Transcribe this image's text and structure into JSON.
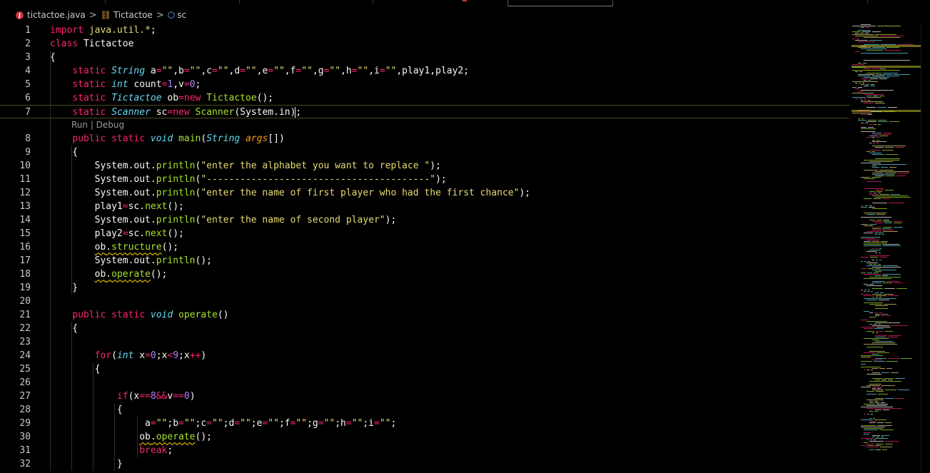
{
  "breadcrumb": {
    "file_icon": "java-file-icon",
    "file": "tictactoe.java",
    "class_icon": "class-icon",
    "class_name": "Tictactoe",
    "field_icon": "field-icon",
    "field": "sc",
    "separator": ">"
  },
  "codelens": {
    "text": "Run | Debug",
    "run": "Run",
    "debug": "Debug"
  },
  "theme": {
    "keyword": "#f92672",
    "type": "#66d9ef",
    "string": "#e6db74",
    "number": "#ae81ff",
    "function": "#a6e22e",
    "param": "#fd971f"
  },
  "lines": [
    {
      "n": "1",
      "tokens": [
        [
          "kw",
          "import"
        ],
        [
          "pl",
          " "
        ],
        [
          "st",
          "java.util.*"
        ],
        [
          "pl",
          ";"
        ]
      ]
    },
    {
      "n": "2",
      "tokens": [
        [
          "kw",
          "class"
        ],
        [
          "pl",
          " Tictactoe"
        ]
      ]
    },
    {
      "n": "3",
      "tokens": [
        [
          "pl",
          "{"
        ]
      ]
    },
    {
      "n": "4",
      "tokens": [
        [
          "pl",
          "    "
        ],
        [
          "kw",
          "static"
        ],
        [
          "pl",
          " "
        ],
        [
          "ty",
          "String"
        ],
        [
          "pl",
          " a"
        ],
        [
          "op",
          "="
        ],
        [
          "st",
          "\"\""
        ],
        [
          "pl",
          ",b"
        ],
        [
          "op",
          "="
        ],
        [
          "st",
          "\"\""
        ],
        [
          "pl",
          ",c"
        ],
        [
          "op",
          "="
        ],
        [
          "st",
          "\"\""
        ],
        [
          "pl",
          ",d"
        ],
        [
          "op",
          "="
        ],
        [
          "st",
          "\"\""
        ],
        [
          "pl",
          ",e"
        ],
        [
          "op",
          "="
        ],
        [
          "st",
          "\"\""
        ],
        [
          "pl",
          ",f"
        ],
        [
          "op",
          "="
        ],
        [
          "st",
          "\"\""
        ],
        [
          "pl",
          ",g"
        ],
        [
          "op",
          "="
        ],
        [
          "st",
          "\"\""
        ],
        [
          "pl",
          ",h"
        ],
        [
          "op",
          "="
        ],
        [
          "st",
          "\"\""
        ],
        [
          "pl",
          ",i"
        ],
        [
          "op",
          "="
        ],
        [
          "st",
          "\"\""
        ],
        [
          "pl",
          ",play1,play2;"
        ]
      ]
    },
    {
      "n": "5",
      "tokens": [
        [
          "pl",
          "    "
        ],
        [
          "kw",
          "static"
        ],
        [
          "pl",
          " "
        ],
        [
          "ty",
          "int"
        ],
        [
          "pl",
          " count"
        ],
        [
          "op",
          "="
        ],
        [
          "nu",
          "1"
        ],
        [
          "pl",
          ",v"
        ],
        [
          "op",
          "="
        ],
        [
          "nu",
          "0"
        ],
        [
          "pl",
          ";"
        ]
      ]
    },
    {
      "n": "6",
      "tokens": [
        [
          "pl",
          "    "
        ],
        [
          "kw",
          "static"
        ],
        [
          "pl",
          " "
        ],
        [
          "ty",
          "Tictactoe"
        ],
        [
          "pl",
          " ob"
        ],
        [
          "op",
          "="
        ],
        [
          "kw",
          "new"
        ],
        [
          "pl",
          " "
        ],
        [
          "fn",
          "Tictactoe"
        ],
        [
          "pl",
          "();"
        ]
      ]
    },
    {
      "n": "7",
      "tokens": [
        [
          "pl",
          "    "
        ],
        [
          "kw",
          "static"
        ],
        [
          "pl",
          " "
        ],
        [
          "ty",
          "Scanner"
        ],
        [
          "pl",
          " sc"
        ],
        [
          "op",
          "="
        ],
        [
          "kw",
          "new"
        ],
        [
          "pl",
          " "
        ],
        [
          "fn",
          "Scanner"
        ],
        [
          "pl",
          "(System.in);"
        ]
      ]
    },
    {
      "n": "8",
      "tokens": [
        [
          "pl",
          "    "
        ],
        [
          "kw",
          "public"
        ],
        [
          "pl",
          " "
        ],
        [
          "kw",
          "static"
        ],
        [
          "pl",
          " "
        ],
        [
          "ty",
          "void"
        ],
        [
          "pl",
          " "
        ],
        [
          "fn",
          "main"
        ],
        [
          "pl",
          "("
        ],
        [
          "ty",
          "String"
        ],
        [
          "pl",
          " "
        ],
        [
          "pa",
          "args"
        ],
        [
          "pl",
          "[])"
        ]
      ]
    },
    {
      "n": "9",
      "tokens": [
        [
          "pl",
          "    {"
        ]
      ]
    },
    {
      "n": "10",
      "tokens": [
        [
          "pl",
          "        System.out."
        ],
        [
          "fn",
          "println"
        ],
        [
          "pl",
          "("
        ],
        [
          "st",
          "\"enter the alphabet you want to replace \""
        ],
        [
          "pl",
          ");"
        ]
      ]
    },
    {
      "n": "11",
      "tokens": [
        [
          "pl",
          "        System.out."
        ],
        [
          "fn",
          "println"
        ],
        [
          "pl",
          "("
        ],
        [
          "st",
          "\"----------------------------------------\""
        ],
        [
          "pl",
          ");"
        ]
      ]
    },
    {
      "n": "12",
      "tokens": [
        [
          "pl",
          "        System.out."
        ],
        [
          "fn",
          "println"
        ],
        [
          "pl",
          "("
        ],
        [
          "st",
          "\"enter the name of first player who had the first chance\""
        ],
        [
          "pl",
          ");"
        ]
      ]
    },
    {
      "n": "13",
      "tokens": [
        [
          "pl",
          "        play1"
        ],
        [
          "op",
          "="
        ],
        [
          "pl",
          "sc."
        ],
        [
          "fn",
          "next"
        ],
        [
          "pl",
          "();"
        ]
      ]
    },
    {
      "n": "14",
      "tokens": [
        [
          "pl",
          "        System.out."
        ],
        [
          "fn",
          "println"
        ],
        [
          "pl",
          "("
        ],
        [
          "st",
          "\"enter the name of second player\""
        ],
        [
          "pl",
          ");"
        ]
      ]
    },
    {
      "n": "15",
      "tokens": [
        [
          "pl",
          "        play2"
        ],
        [
          "op",
          "="
        ],
        [
          "pl",
          "sc."
        ],
        [
          "fn",
          "next"
        ],
        [
          "pl",
          "();"
        ]
      ]
    },
    {
      "n": "16",
      "tokens": [
        [
          "pl",
          "        "
        ],
        [
          "pl",
          "ob",
          "w"
        ],
        [
          "pl",
          ".",
          "w"
        ],
        [
          "fn",
          "structure",
          "w"
        ],
        [
          "pl",
          "();"
        ]
      ]
    },
    {
      "n": "17",
      "tokens": [
        [
          "pl",
          "        System.out."
        ],
        [
          "fn",
          "println"
        ],
        [
          "pl",
          "();"
        ]
      ]
    },
    {
      "n": "18",
      "tokens": [
        [
          "pl",
          "        "
        ],
        [
          "pl",
          "ob",
          "w"
        ],
        [
          "pl",
          ".",
          "w"
        ],
        [
          "fn",
          "operate",
          "w"
        ],
        [
          "pl",
          "();"
        ]
      ]
    },
    {
      "n": "19",
      "tokens": [
        [
          "pl",
          "    }"
        ]
      ]
    },
    {
      "n": "20",
      "tokens": []
    },
    {
      "n": "21",
      "tokens": [
        [
          "pl",
          "    "
        ],
        [
          "kw",
          "public"
        ],
        [
          "pl",
          " "
        ],
        [
          "kw",
          "static"
        ],
        [
          "pl",
          " "
        ],
        [
          "ty",
          "void"
        ],
        [
          "pl",
          " "
        ],
        [
          "fn",
          "operate"
        ],
        [
          "pl",
          "()"
        ]
      ]
    },
    {
      "n": "22",
      "tokens": [
        [
          "pl",
          "    {"
        ]
      ]
    },
    {
      "n": "23",
      "tokens": []
    },
    {
      "n": "24",
      "tokens": [
        [
          "pl",
          "        "
        ],
        [
          "kw",
          "for"
        ],
        [
          "pl",
          "("
        ],
        [
          "ty",
          "int"
        ],
        [
          "pl",
          " x"
        ],
        [
          "op",
          "="
        ],
        [
          "nu",
          "0"
        ],
        [
          "pl",
          ";x"
        ],
        [
          "op",
          "<"
        ],
        [
          "nu",
          "9"
        ],
        [
          "pl",
          ";x"
        ],
        [
          "op",
          "++"
        ],
        [
          "pl",
          ")"
        ]
      ]
    },
    {
      "n": "25",
      "tokens": [
        [
          "pl",
          "        {"
        ]
      ]
    },
    {
      "n": "26",
      "tokens": []
    },
    {
      "n": "27",
      "tokens": [
        [
          "pl",
          "            "
        ],
        [
          "kw",
          "if"
        ],
        [
          "pl",
          "(x"
        ],
        [
          "op",
          "=="
        ],
        [
          "nu",
          "8"
        ],
        [
          "op",
          "&&"
        ],
        [
          "pl",
          "v"
        ],
        [
          "op",
          "=="
        ],
        [
          "nu",
          "0"
        ],
        [
          "pl",
          ")"
        ]
      ]
    },
    {
      "n": "28",
      "tokens": [
        [
          "pl",
          "            {"
        ]
      ]
    },
    {
      "n": "29",
      "tokens": [
        [
          "pl",
          "                 a"
        ],
        [
          "op",
          "="
        ],
        [
          "st",
          "\"\""
        ],
        [
          "pl",
          ";b"
        ],
        [
          "op",
          "="
        ],
        [
          "st",
          "\"\""
        ],
        [
          "pl",
          ";c"
        ],
        [
          "op",
          "="
        ],
        [
          "st",
          "\"\""
        ],
        [
          "pl",
          ";d"
        ],
        [
          "op",
          "="
        ],
        [
          "st",
          "\"\""
        ],
        [
          "pl",
          ";e"
        ],
        [
          "op",
          "="
        ],
        [
          "st",
          "\"\""
        ],
        [
          "pl",
          ";f"
        ],
        [
          "op",
          "="
        ],
        [
          "st",
          "\"\""
        ],
        [
          "pl",
          ";g"
        ],
        [
          "op",
          "="
        ],
        [
          "st",
          "\"\""
        ],
        [
          "pl",
          ";h"
        ],
        [
          "op",
          "="
        ],
        [
          "st",
          "\"\""
        ],
        [
          "pl",
          ";i"
        ],
        [
          "op",
          "="
        ],
        [
          "st",
          "\"\""
        ],
        [
          "pl",
          ";"
        ]
      ]
    },
    {
      "n": "30",
      "tokens": [
        [
          "pl",
          "                "
        ],
        [
          "pl",
          "ob",
          "w"
        ],
        [
          "pl",
          ".",
          "w"
        ],
        [
          "fn",
          "operate",
          "w"
        ],
        [
          "pl",
          "();"
        ]
      ]
    },
    {
      "n": "31",
      "tokens": [
        [
          "pl",
          "                "
        ],
        [
          "kw",
          "break"
        ],
        [
          "pl",
          ";"
        ]
      ]
    },
    {
      "n": "32",
      "tokens": [
        [
          "pl",
          "            }"
        ]
      ]
    }
  ]
}
